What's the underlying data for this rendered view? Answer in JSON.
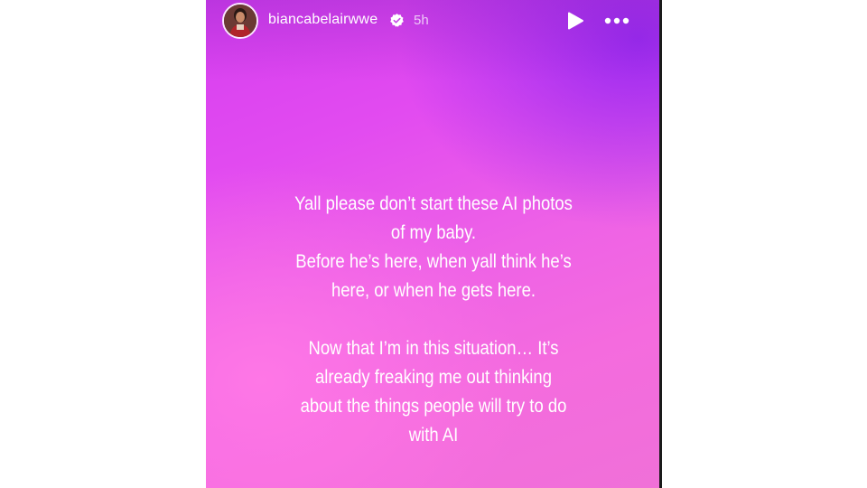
{
  "header": {
    "username": "biancabelairwwe",
    "time": "5h",
    "avatar_icon": "avatar-photo",
    "verified_icon": "verified-badge-icon",
    "play_icon": "play-icon",
    "more_icon": "more-options-icon"
  },
  "story": {
    "paragraph1_lines": [
      "Yall please don’t start these AI photos",
      "of my baby.",
      "Before he’s here, when yall think he’s",
      "here, or when he gets here."
    ],
    "paragraph2_lines": [
      "Now that I’m in this situation… It’s",
      "already freaking me out thinking",
      "about the things people will try to do",
      "with AI"
    ]
  },
  "colors": {
    "gradient_top_right": "#9628f0",
    "gradient_mid": "#e24bf0",
    "gradient_bottom": "#f070d8",
    "text": "#ffffff"
  }
}
